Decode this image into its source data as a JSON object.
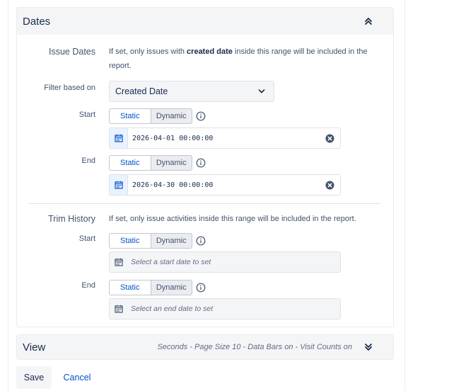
{
  "dates_panel": {
    "title": "Dates",
    "issue_dates": {
      "label": "Issue Dates",
      "description_prefix": "If set, only issues with ",
      "description_bold": "created date",
      "description_suffix": " inside this range will be included in the report.",
      "filter_label": "Filter based on",
      "filter_value": "Created Date",
      "start": {
        "label": "Start",
        "toggle_static": "Static",
        "toggle_dynamic": "Dynamic",
        "active": "Static",
        "value": "2026-04-01 00:00:00"
      },
      "end": {
        "label": "End",
        "toggle_static": "Static",
        "toggle_dynamic": "Dynamic",
        "active": "Static",
        "value": "2026-04-30 00:00:00"
      }
    },
    "trim_history": {
      "label": "Trim History",
      "description": "If set, only issue activities inside this range will be included in the report.",
      "start": {
        "label": "Start",
        "toggle_static": "Static",
        "toggle_dynamic": "Dynamic",
        "active": "Static",
        "placeholder": "Select a start date to set"
      },
      "end": {
        "label": "End",
        "toggle_static": "Static",
        "toggle_dynamic": "Dynamic",
        "active": "Static",
        "placeholder": "Select an end date to set"
      }
    }
  },
  "view_panel": {
    "title": "View",
    "summary": "Seconds - Page Size 10 - Data Bars on - Visit Counts on"
  },
  "actions": {
    "save_label": "Save",
    "cancel_label": "Cancel"
  },
  "colors": {
    "accent": "#0052cc",
    "panel_bg": "#f4f5f7",
    "text": "#172b4d"
  }
}
